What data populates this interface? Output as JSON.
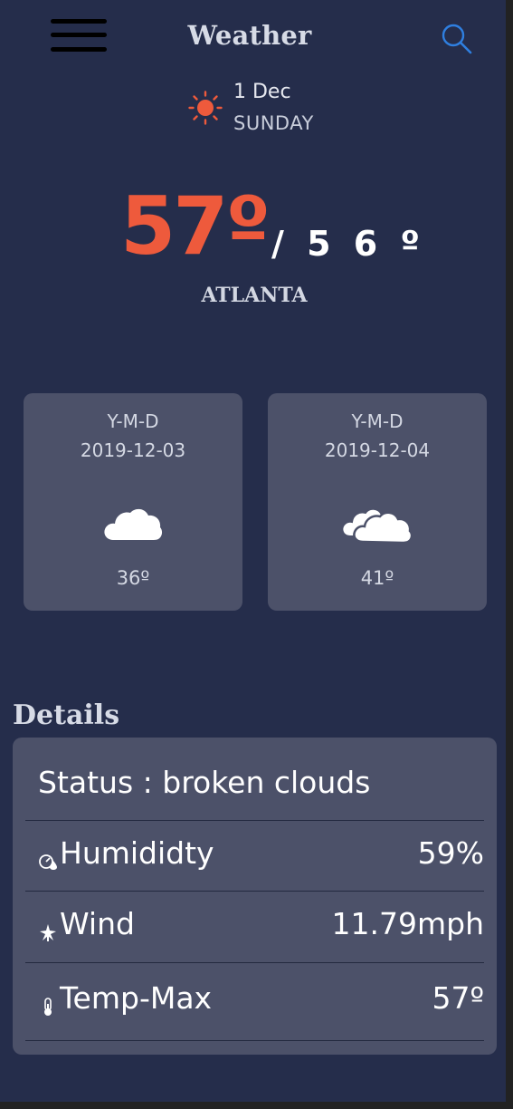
{
  "header": {
    "title": "Weather"
  },
  "date": {
    "day": "1 Dec",
    "weekday": "SUNDAY"
  },
  "current": {
    "temp": "57º",
    "feels": "/ 5 6 º",
    "city": "ATLANTA"
  },
  "forecast": [
    {
      "label": "Y-M-D",
      "date": "2019-12-03",
      "temp": "36º",
      "icon": "cloud-icon"
    },
    {
      "label": "Y-M-D",
      "date": "2019-12-04",
      "temp": "41º",
      "icon": "clouds-icon"
    }
  ],
  "details": {
    "title": "Details",
    "status": "Status : broken clouds",
    "rows": [
      {
        "label": "Humididty",
        "value": "59%",
        "icon": "gauge-icon"
      },
      {
        "label": "Wind",
        "value": "11.79mph",
        "icon": "wind-icon"
      },
      {
        "label": "Temp-Max",
        "value": "57º",
        "icon": "thermometer-icon"
      }
    ]
  },
  "colors": {
    "background": "#252d4b",
    "card": "#4c5169",
    "accent": "#ee5a3c",
    "search": "#2f7fe0"
  }
}
